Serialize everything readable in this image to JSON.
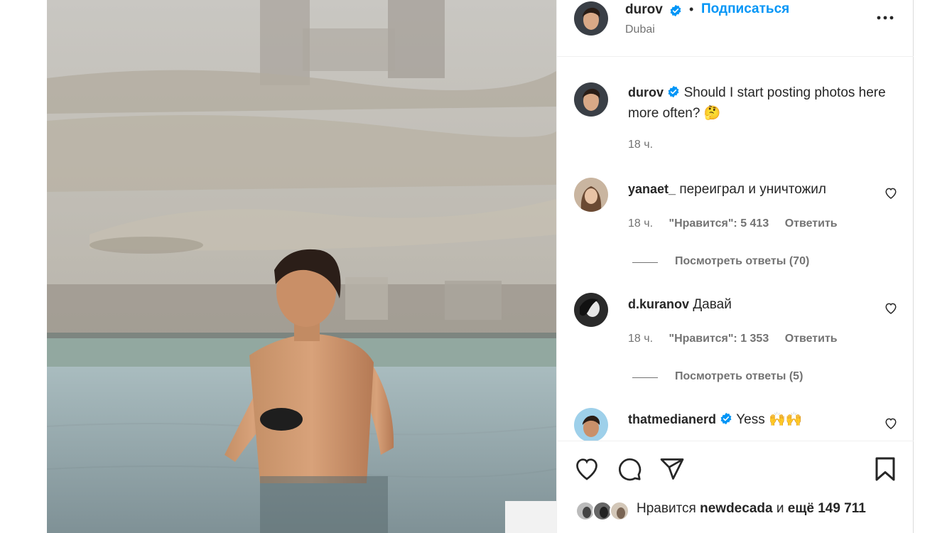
{
  "header": {
    "username": "durov",
    "dot": "•",
    "follow_label": "Подписаться",
    "location": "Dubai",
    "more_icon": "more-horizontal-icon"
  },
  "caption": {
    "username": "durov",
    "text": "Should I start posting photos here more often? 🤔",
    "time": "18 ч."
  },
  "comments": [
    {
      "username": "yanaet_",
      "verified": false,
      "text": "переиграл и уничтожил",
      "time": "18 ч.",
      "likes": "\"Нравится\": 5 413",
      "reply_label": "Ответить",
      "view_replies": "Посмотреть ответы (70)"
    },
    {
      "username": "d.kuranov",
      "verified": false,
      "text": "Давай",
      "time": "18 ч.",
      "likes": "\"Нравится\": 1 353",
      "reply_label": "Ответить",
      "view_replies": "Посмотреть ответы (5)"
    },
    {
      "username": "thatmedianerd",
      "verified": true,
      "text": "Yess 🙌🙌"
    }
  ],
  "actions": {
    "like_icon": "heart-icon",
    "comment_icon": "comment-icon",
    "share_icon": "send-icon",
    "save_icon": "bookmark-icon"
  },
  "likes": {
    "prefix": "Нравится",
    "user": "newdecada",
    "connector": "и",
    "others": "ещё 149 711"
  },
  "colors": {
    "accent": "#0095f6",
    "verified": "#0095f6",
    "secondary_text": "#737373",
    "border": "#dbdbdb"
  }
}
